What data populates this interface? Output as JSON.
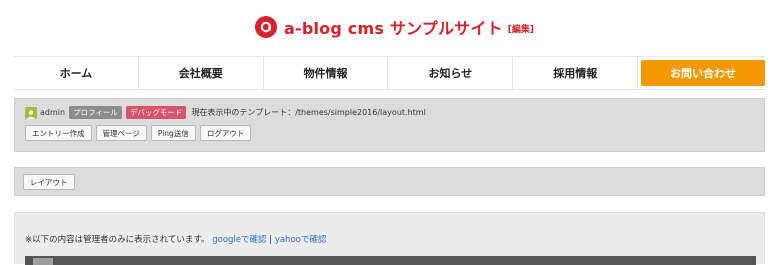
{
  "header": {
    "site_title": "a-blog cms サンプルサイト",
    "edit_label": "[編集]",
    "logo_icon": "a-blog-logo-icon",
    "brand_color": "#d8222a"
  },
  "nav": {
    "items": [
      {
        "label": "ホーム"
      },
      {
        "label": "会社概要"
      },
      {
        "label": "物件情報"
      },
      {
        "label": "お知らせ"
      },
      {
        "label": "採用情報"
      }
    ],
    "cta_label": "お問い合わせ",
    "cta_color": "#f39800"
  },
  "admin": {
    "user_icon": "user-icon",
    "user_name": "admin",
    "profile_badge": "プロフィール",
    "debug_badge": "デバッグモード",
    "template_text": "現在表示中のテンプレート：/themes/simple2016/layout.html",
    "buttons": {
      "entry_create": "エントリー作成",
      "admin_page": "管理ページ",
      "ping": "Ping送信",
      "logout": "ログアウト"
    }
  },
  "layout_bar": {
    "button_label": "レイアウト"
  },
  "confirm": {
    "text": "※以下の内容は管理者のみに表示されています。",
    "google_link": "googleで確認",
    "separator": "|",
    "yahoo_link": "yahooで確認"
  }
}
